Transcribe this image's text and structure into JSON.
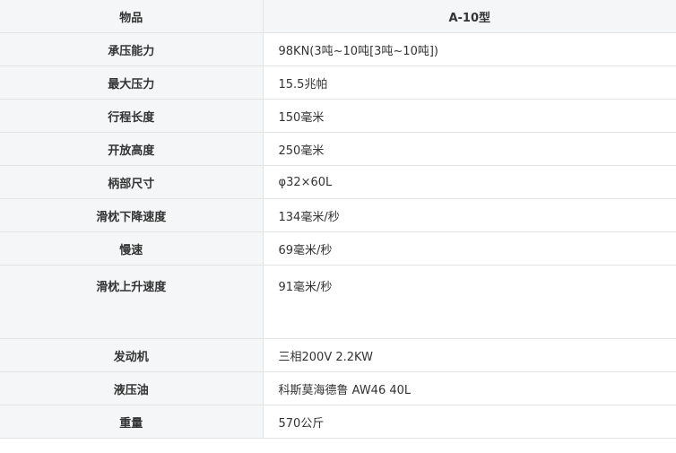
{
  "header": {
    "item_label": "物品",
    "model_label": "A-10型"
  },
  "rows": [
    {
      "key": "承压能力",
      "value": "98KN(3吨~10吨[3吨~10吨])"
    },
    {
      "key": "最大压力",
      "value": "15.5兆帕"
    },
    {
      "key": "行程长度",
      "value": "150毫米"
    },
    {
      "key": "开放高度",
      "value": "250毫米"
    },
    {
      "key": "柄部尺寸",
      "value": "φ32×60L"
    },
    {
      "key": "滑枕下降速度",
      "value": "134毫米/秒"
    },
    {
      "key": "慢速",
      "value": "69毫米/秒"
    },
    {
      "key": "滑枕上升速度",
      "value": "91毫米/秒"
    },
    {
      "key": "发动机",
      "value": "三相200V 2.2KW"
    },
    {
      "key": "液压油",
      "value": "科斯莫海德鲁 AW46 40L"
    },
    {
      "key": "重量",
      "value": "570公斤"
    }
  ]
}
